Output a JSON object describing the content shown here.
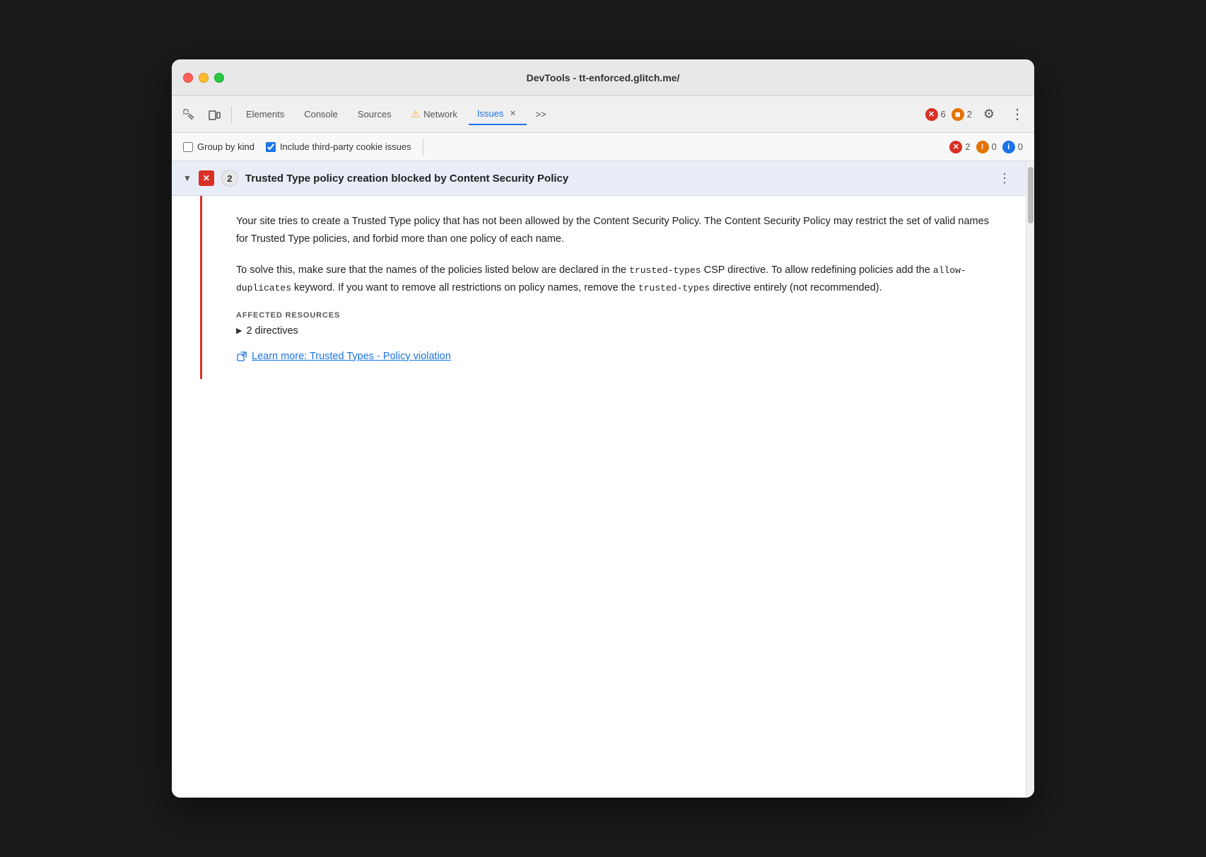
{
  "window": {
    "title": "DevTools - tt-enforced.glitch.me/"
  },
  "toolbar": {
    "tabs": [
      {
        "id": "elements",
        "label": "Elements",
        "active": false
      },
      {
        "id": "console",
        "label": "Console",
        "active": false
      },
      {
        "id": "sources",
        "label": "Sources",
        "active": false
      },
      {
        "id": "network",
        "label": "Network",
        "active": false,
        "warning": true
      },
      {
        "id": "issues",
        "label": "Issues",
        "active": true,
        "closeable": true
      }
    ],
    "more_tabs_label": ">>",
    "error_count": "6",
    "warning_count": "2",
    "settings_label": "⚙",
    "more_options_label": "⋮"
  },
  "issues_toolbar": {
    "group_by_kind_label": "Group by kind",
    "group_by_kind_checked": false,
    "include_third_party_label": "Include third-party cookie issues",
    "include_third_party_checked": true,
    "error_count": "2",
    "warning_count": "0",
    "info_count": "0"
  },
  "issue": {
    "title": "Trusted Type policy creation blocked by Content Security Policy",
    "count": "2",
    "description_p1": "Your site tries to create a Trusted Type policy that has not been allowed by the Content Security Policy. The Content Security Policy may restrict the set of valid names for Trusted Type policies, and forbid more than one policy of each name.",
    "description_p2_before": "To solve this, make sure that the names of the policies listed below are declared in the ",
    "description_p2_code1": "trusted-types",
    "description_p2_middle": " CSP directive. To allow redefining policies add the ",
    "description_p2_code2": "allow-\nduplicates",
    "description_p2_after": " keyword. If you want to remove all restrictions on policy names, remove the ",
    "description_p2_code3": "trusted-types",
    "description_p2_end": " directive entirely (not recommended).",
    "affected_resources_label": "AFFECTED RESOURCES",
    "directives_label": "2 directives",
    "learn_more_label": "Learn more: Trusted Types - Policy violation"
  }
}
